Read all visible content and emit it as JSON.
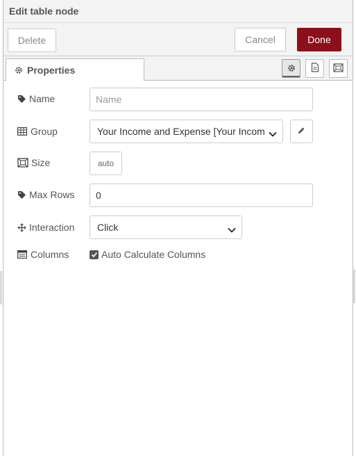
{
  "header": {
    "title": "Edit table node"
  },
  "toolbar": {
    "delete_label": "Delete",
    "cancel_label": "Cancel",
    "done_label": "Done"
  },
  "tabs": {
    "properties_label": "Properties"
  },
  "form": {
    "name": {
      "label": "Name",
      "placeholder": "Name",
      "value": ""
    },
    "group": {
      "label": "Group",
      "value": "Your Income and Expense [Your Incom"
    },
    "size": {
      "label": "Size",
      "value": "auto"
    },
    "max_rows": {
      "label": "Max Rows",
      "value": "0"
    },
    "interaction": {
      "label": "Interaction",
      "value": "Click"
    },
    "columns": {
      "label": "Columns",
      "checkbox_label": "Auto Calculate Columns",
      "checked": true
    }
  },
  "colors": {
    "done_bg": "#8c101c",
    "header_bg": "#f3f3f3",
    "border": "#cccccc"
  },
  "icons": [
    "gear-icon",
    "tag-icon",
    "table-icon",
    "expand-icon",
    "arrows-icon",
    "list-icon",
    "pencil-icon",
    "document-icon",
    "frame-icon",
    "chevron-down-icon",
    "checkmark-icon"
  ]
}
